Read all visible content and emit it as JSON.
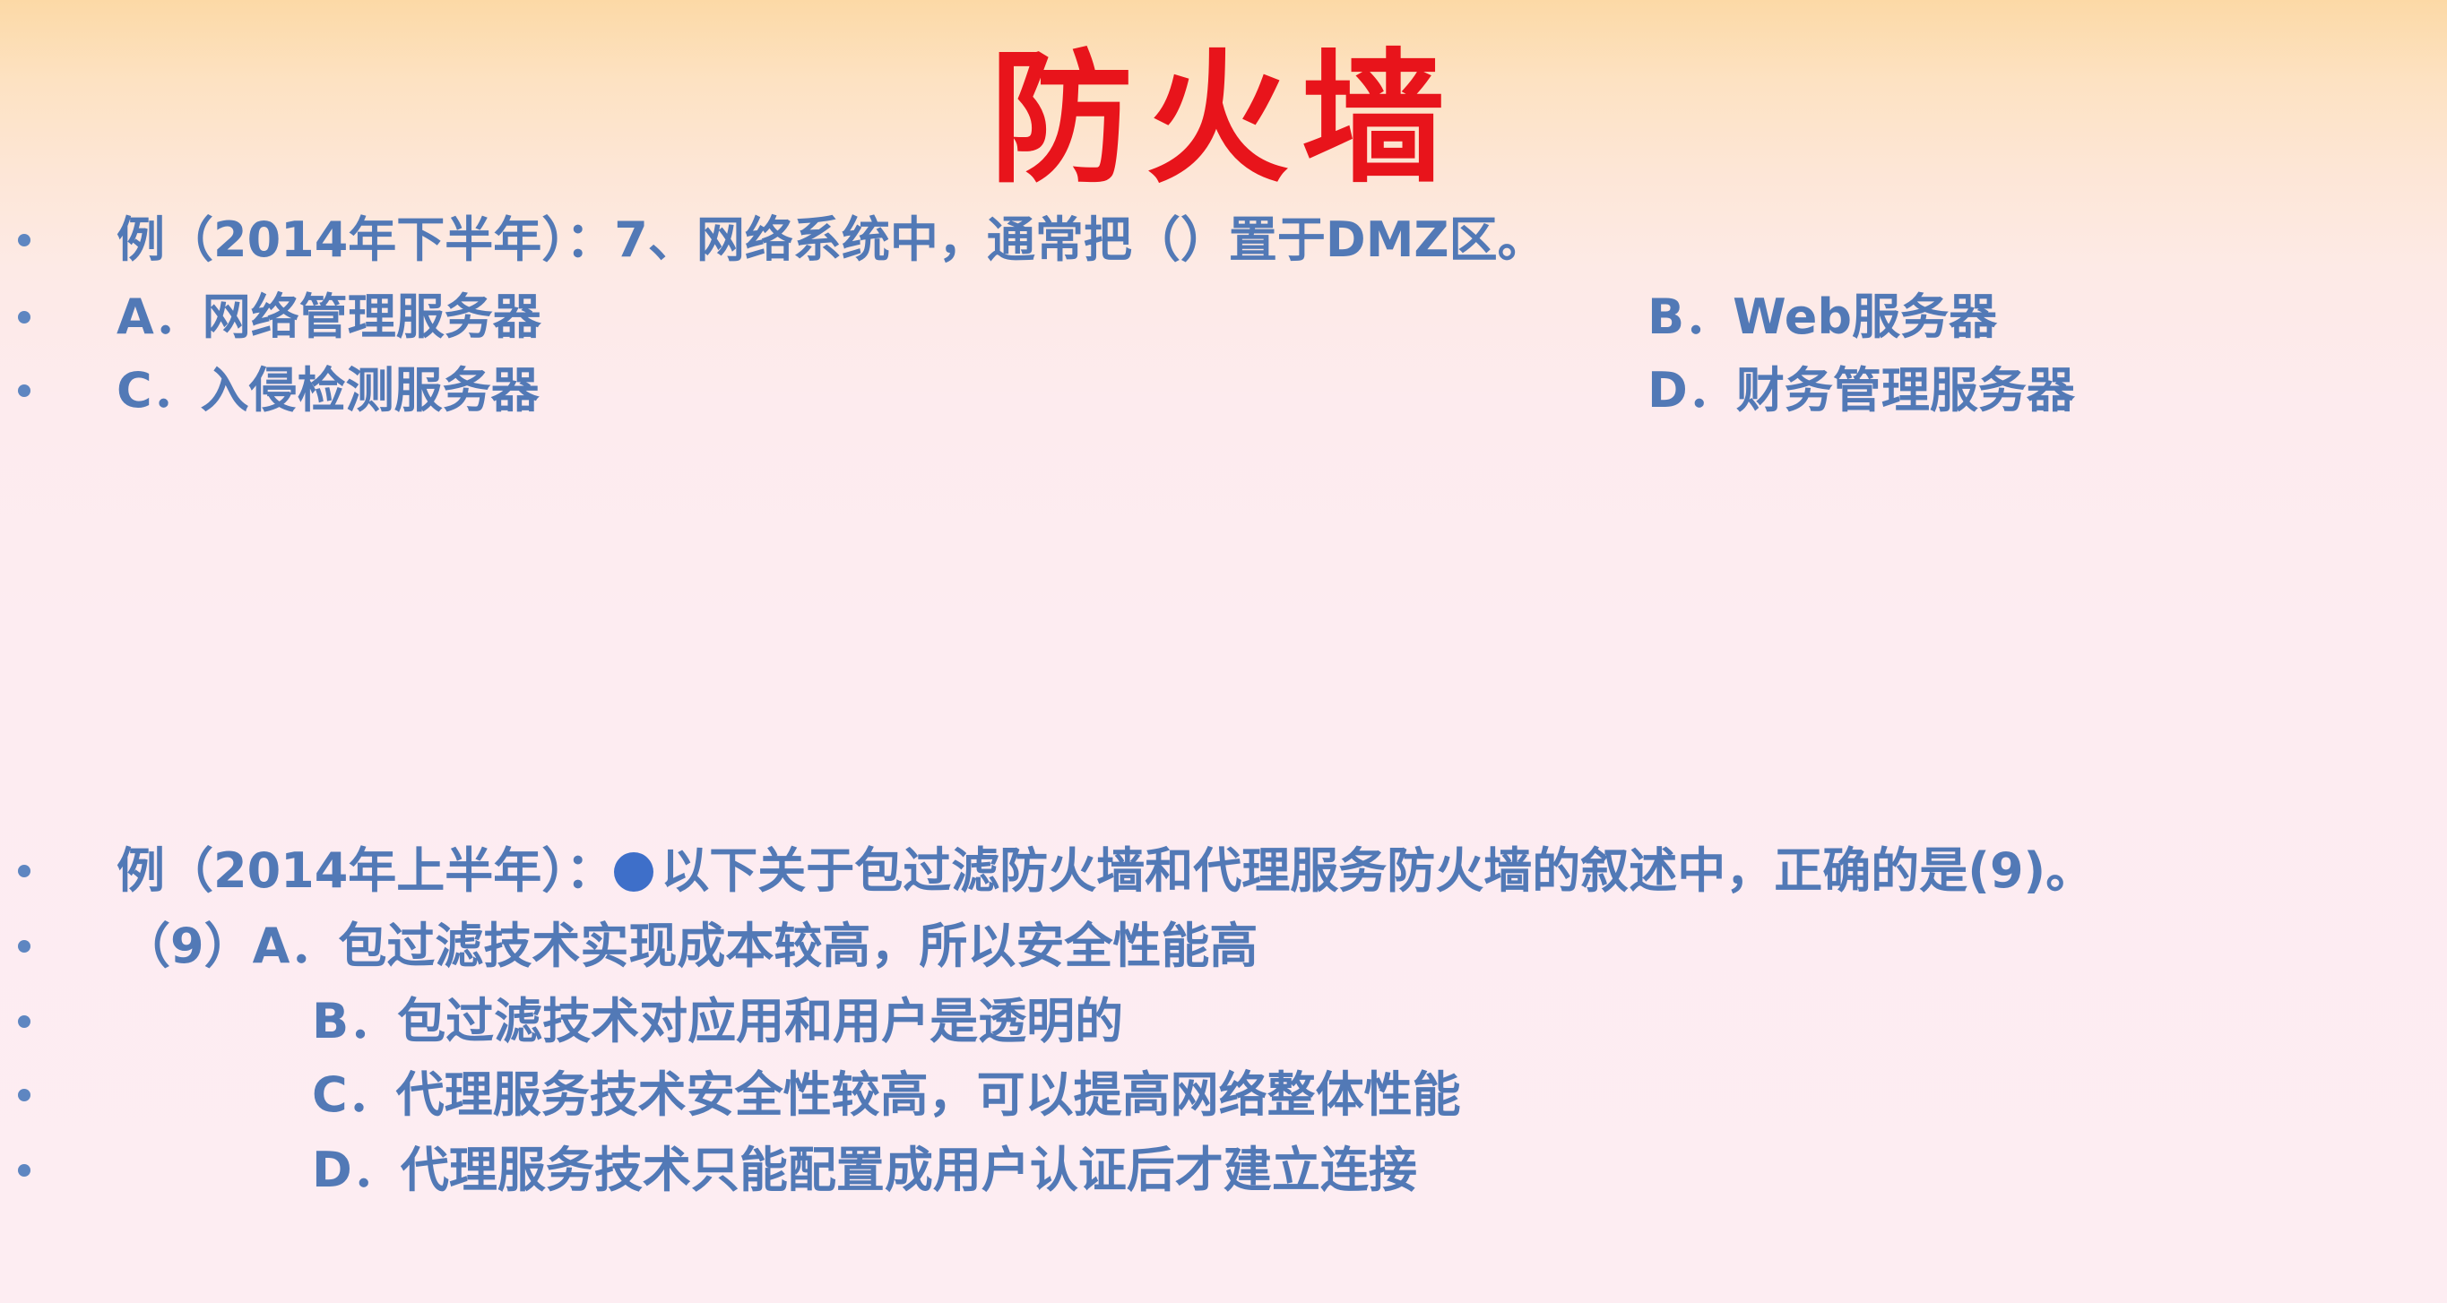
{
  "title": "防火墙",
  "q1": {
    "stem": "例（2014年下半年）：7、网络系统中，通常把（）置于DMZ区。",
    "option_a": "A．网络管理服务器",
    "option_b": "B．Web服务器",
    "option_c": "C．入侵检测服务器",
    "option_d": "D．财务管理服务器"
  },
  "q2": {
    "stem_prefix": "例（2014年上半年）：",
    "stem_text": "以下关于包过滤防火墙和代理服务防火墙的叙述中，正确的是(9)。",
    "option_a": "（9）A．包过滤技术实现成本较高，所以安全性能高",
    "option_b": "B．包过滤技术对应用和用户是透明的",
    "option_c": "C．代理服务技术安全性较高，可以提高网络整体性能",
    "option_d": "D．代理服务技术只能配置成用户认证后才建立连接"
  },
  "colors": {
    "title": "#e8141b",
    "text": "#5279b6",
    "bullet": "#5e86c1",
    "dot": "#3e6fc9"
  }
}
